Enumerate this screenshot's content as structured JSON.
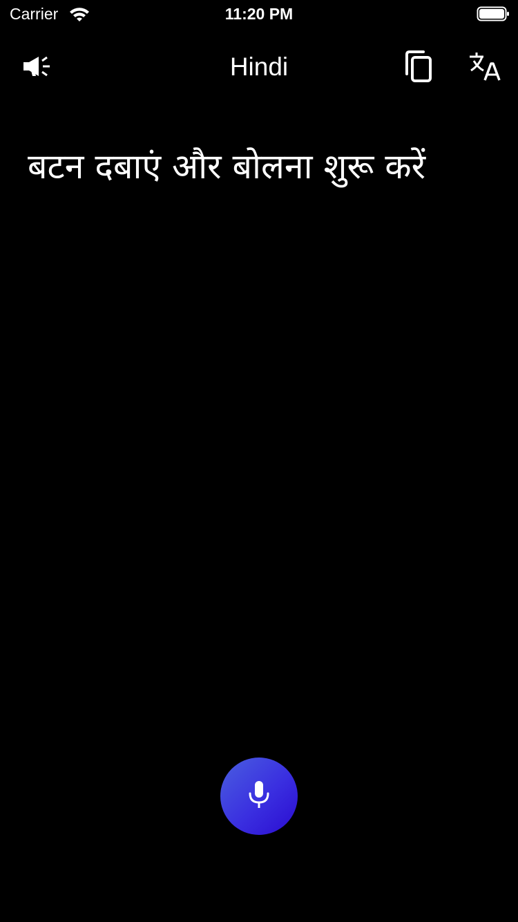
{
  "status_bar": {
    "carrier": "Carrier",
    "time": "11:20 PM",
    "icons": [
      "wifi-icon",
      "battery-icon"
    ]
  },
  "header": {
    "title": "Hindi",
    "left_icon": "speaker-icon",
    "right_icons": [
      "copy-icon",
      "translate-icon"
    ]
  },
  "main": {
    "prompt": "बटन दबाएं और बोलना शुरू करें"
  },
  "mic": {
    "icon": "microphone-icon"
  },
  "colors": {
    "background": "#000000",
    "text": "#ffffff",
    "mic_gradient_start": "#4a5fe0",
    "mic_gradient_end": "#2a0bd0"
  }
}
